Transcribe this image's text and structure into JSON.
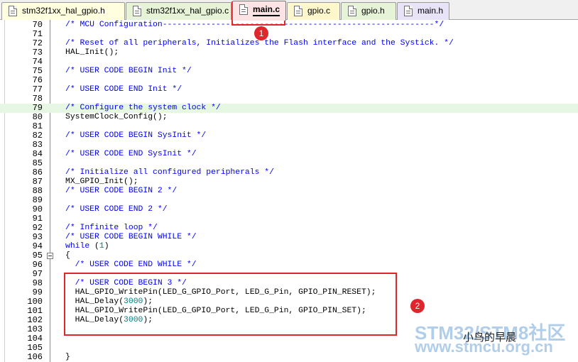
{
  "tabs": [
    {
      "label": "stm32f1xx_hal_gpio.h",
      "color": "#ffffe0",
      "active": false
    },
    {
      "label": "stm32f1xx_hal_gpio.c",
      "color": "#e6f3d6",
      "active": false
    },
    {
      "label": "main.c",
      "color": "#fde3e3",
      "active": true
    },
    {
      "label": "gpio.c",
      "color": "#fff7cc",
      "active": false
    },
    {
      "label": "gpio.h",
      "color": "#e6f3d6",
      "active": false
    },
    {
      "label": "main.h",
      "color": "#e9e3f8",
      "active": false
    }
  ],
  "editor": {
    "lines": [
      {
        "n": "70",
        "segs": [
          {
            "t": "/* MCU Configuration--------------------------------------------------------*/",
            "k": "c"
          }
        ]
      },
      {
        "n": "71",
        "segs": []
      },
      {
        "n": "72",
        "segs": [
          {
            "t": "/* Reset of all peripherals, Initializes the Flash interface and the Systick. */",
            "k": "c"
          }
        ]
      },
      {
        "n": "73",
        "segs": [
          {
            "t": "HAL_Init();",
            "k": "p"
          }
        ]
      },
      {
        "n": "74",
        "segs": []
      },
      {
        "n": "75",
        "segs": [
          {
            "t": "/* USER CODE BEGIN Init */",
            "k": "c"
          }
        ]
      },
      {
        "n": "76",
        "segs": []
      },
      {
        "n": "77",
        "segs": [
          {
            "t": "/* USER CODE END Init */",
            "k": "c"
          }
        ]
      },
      {
        "n": "78",
        "segs": []
      },
      {
        "n": "79",
        "segs": [
          {
            "t": "/* Configure the system clock */",
            "k": "c"
          }
        ],
        "hl": true
      },
      {
        "n": "80",
        "segs": [
          {
            "t": "SystemClock_Config();",
            "k": "p"
          }
        ]
      },
      {
        "n": "81",
        "segs": []
      },
      {
        "n": "82",
        "segs": [
          {
            "t": "/* USER CODE BEGIN SysInit */",
            "k": "c"
          }
        ]
      },
      {
        "n": "83",
        "segs": []
      },
      {
        "n": "84",
        "segs": [
          {
            "t": "/* USER CODE END SysInit */",
            "k": "c"
          }
        ]
      },
      {
        "n": "85",
        "segs": []
      },
      {
        "n": "86",
        "segs": [
          {
            "t": "/* Initialize all configured peripherals */",
            "k": "c"
          }
        ]
      },
      {
        "n": "87",
        "segs": [
          {
            "t": "MX_GPIO_Init();",
            "k": "p"
          }
        ]
      },
      {
        "n": "88",
        "segs": [
          {
            "t": "/* USER CODE BEGIN 2 */",
            "k": "c"
          }
        ]
      },
      {
        "n": "89",
        "segs": []
      },
      {
        "n": "90",
        "segs": [
          {
            "t": "/* USER CODE END 2 */",
            "k": "c"
          }
        ]
      },
      {
        "n": "91",
        "segs": []
      },
      {
        "n": "92",
        "segs": [
          {
            "t": "/* Infinite loop */",
            "k": "c"
          }
        ]
      },
      {
        "n": "93",
        "segs": [
          {
            "t": "/* USER CODE BEGIN WHILE */",
            "k": "c"
          }
        ]
      },
      {
        "n": "94",
        "segs": [
          {
            "t": "while",
            "k": "kw"
          },
          {
            "t": " (",
            "k": "p"
          },
          {
            "t": "1",
            "k": "num"
          },
          {
            "t": ")",
            "k": "p"
          }
        ]
      },
      {
        "n": "95",
        "segs": [
          {
            "t": "{",
            "k": "p"
          }
        ],
        "fold": true
      },
      {
        "n": "96",
        "segs": [
          {
            "t": "  /* USER CODE END WHILE */",
            "k": "c"
          }
        ]
      },
      {
        "n": "97",
        "segs": []
      },
      {
        "n": "98",
        "segs": [
          {
            "t": "  /* USER CODE BEGIN 3 */",
            "k": "c"
          }
        ]
      },
      {
        "n": "99",
        "segs": [
          {
            "t": "  HAL_GPIO_WritePin(LED_G_GPIO_Port, LED_G_Pin, GPIO_PIN_RESET);",
            "k": "p"
          }
        ]
      },
      {
        "n": "100",
        "segs": [
          {
            "t": "  HAL_Delay(",
            "k": "p"
          },
          {
            "t": "3000",
            "k": "num"
          },
          {
            "t": ");",
            "k": "p"
          }
        ]
      },
      {
        "n": "101",
        "segs": [
          {
            "t": "  HAL_GPIO_WritePin(LED_G_GPIO_Port, LED_G_Pin, GPIO_PIN_SET);",
            "k": "p"
          }
        ]
      },
      {
        "n": "102",
        "segs": [
          {
            "t": "  HAL_Delay(",
            "k": "p"
          },
          {
            "t": "3000",
            "k": "num"
          },
          {
            "t": ");",
            "k": "p"
          }
        ]
      },
      {
        "n": "103",
        "segs": []
      },
      {
        "n": "104",
        "segs": []
      },
      {
        "n": "105",
        "segs": []
      },
      {
        "n": "106",
        "segs": [
          {
            "t": "}",
            "k": "p"
          }
        ]
      }
    ]
  },
  "annotations": {
    "badge1": "1",
    "badge2": "2",
    "color": "#e0262d"
  },
  "watermark": {
    "title": "STM32/STM8社区",
    "url": "www.stmcu.org.cn",
    "author": "小鸟的早晨"
  }
}
